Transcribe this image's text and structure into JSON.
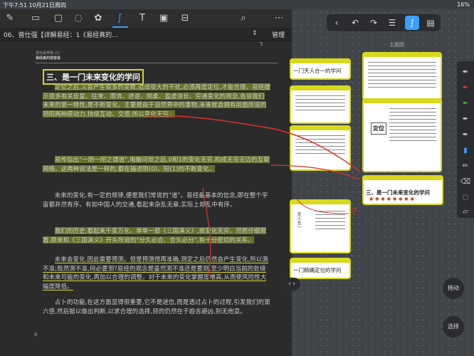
{
  "status": {
    "time_date": "下午7:51  10月21日周四",
    "battery": "16%"
  },
  "reader": {
    "doc_title": "06、曾仕强【详解易经：1《易经真的...",
    "sort_icon": "⇕",
    "manage_label": "管理",
    "top_page_number": "5",
    "book_head_line1": "现代易学网 (1)",
    "book_head_line2": "易经真的很容易",
    "heading": "三、是一门未来变化的学问",
    "paragraphs": [
      "定位之后,又会产生很多的变数,造成很大的干扰,必须再度定位,才能合理。易经提示很多有关反复、往来、周流、进退、刚柔、盈虚消长、穷通变化的观念,告诉我们未来的第一特性,是不断变化。主要是由于自然界中的事物,未来就会拥有前面所说的阴阳两种原动力,持续互动、交感,所以变化无穷。",
      "易传指出\"一阴一阳之谓道\",电脑问世之后,0和1的变化无穷,构成无穷无边的互联网络。这两种说法是一样的,都在描述阴(0)、阳(1)的不断变化。",
      "未来的变化,有一定的规律,便是我们常说的\"道\"。易经最基本的信念,即在整个宇宙都井然有序。有如中国人的交通,看起来杂乱无章,实际上却乱中有序。",
      "我们的历史,看起来千变万化。单单一部《三国演义》,就变化无穷。然而仔细观看,原来和《三国演义》开头所说的\"分久必合、合久必分\",有十分密切的关系。",
      "未来会变化,因此需要预测。但是预测得再准确,测定之后仍然会产生变化,所以测不准;既然测不准,何必要测?易经的观念是虽然测不准还是要测,至少明白当前的处境和未来可能的变化,再加以合理的调整。对于未来的变化掌握度增高,从而使风险性大幅度降低。",
      "占卜的功能,在这方面显得很重要,它不是迷信,而是透过占卜的过程,引发我们的第六感,然后据以做出判断,以求合理的选择,目的仍然在于趋吉避凶,别无他意。"
    ],
    "bottom_page_number": "6"
  },
  "toolbar_icons": [
    "pen-icon",
    "highlight-icon",
    "shape-icon",
    "lasso-icon",
    "sticker-icon",
    "ink-icon",
    "textbox-icon",
    "image-icon",
    "clip-icon",
    "search-icon",
    "more-icon"
  ],
  "canvas": {
    "map_label": "主题图",
    "card_titles": [
      "一门天人合一的学问",
      "三、是一门未来变化的学问",
      "一门精确定位的学问"
    ],
    "dingwei": "定位",
    "renhe": "天人合一"
  },
  "right_buttons": {
    "drag": "拖动",
    "select": "选择",
    "nav": "‹ ›"
  },
  "colors": {
    "accent": "#3aa0ff",
    "highlight": "#d8d81c",
    "annotation": "#e03030"
  }
}
